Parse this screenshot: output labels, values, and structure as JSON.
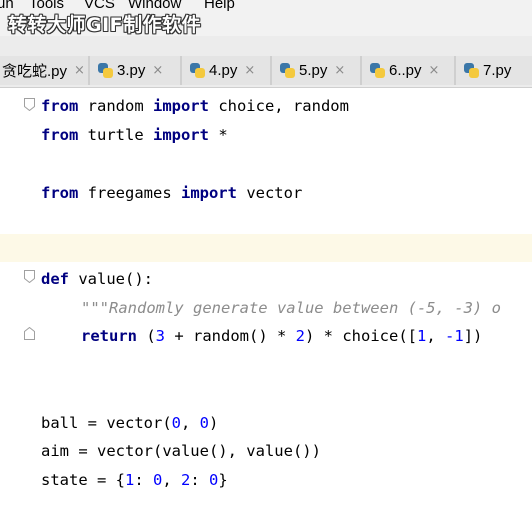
{
  "menu": {
    "items": [
      "un",
      "Tools",
      "VCS",
      "Window",
      "Help"
    ]
  },
  "watermark": "转转大师GIF制作软件",
  "tabs": [
    {
      "label": "贪吃蛇.py",
      "icon": "python-file-icon"
    },
    {
      "label": "3.py",
      "icon": "python-file-icon"
    },
    {
      "label": "4.py",
      "icon": "python-file-icon"
    },
    {
      "label": "5.py",
      "icon": "python-file-icon"
    },
    {
      "label": "6..py",
      "icon": "python-file-icon"
    },
    {
      "label": "7.py",
      "icon": "python-file-icon"
    }
  ],
  "tab_close_glyph": "×",
  "code": {
    "line1": {
      "kw1": "from",
      "t1": " random ",
      "kw2": "import",
      "t2": " choice, random"
    },
    "line2": {
      "kw1": "from",
      "t1": " turtle ",
      "kw2": "import",
      "t2": " *"
    },
    "line3": {
      "kw1": "from",
      "t1": " freegames ",
      "kw2": "import",
      "t2": " vector"
    },
    "line4": {
      "kw1": "def",
      "t1": " value():"
    },
    "line5": {
      "doc": "\"\"\"Randomly generate value between (-5, -3) o"
    },
    "line6": {
      "kw1": "return",
      "p1": " (",
      "n1": "3",
      "p2": " + random() * ",
      "n2": "2",
      "p3": ") * choice([",
      "n3": "1",
      "p4": ", ",
      "n4": "-1",
      "p5": "])"
    },
    "line7": {
      "t1": "ball = vector(",
      "n1": "0",
      "t2": ", ",
      "n2": "0",
      "t3": ")"
    },
    "line8": {
      "t1": "aim = vector(value(), value())"
    },
    "line9": {
      "t1": "state = {",
      "n1": "1",
      "t2": ": ",
      "n2": "0",
      "t3": ", ",
      "n3": "2",
      "t4": ": ",
      "n4": "0",
      "t5": "}"
    }
  },
  "colors": {
    "keyword": "#000080",
    "number": "#0000ff",
    "docstring": "#8c8c8c",
    "current_line": "#fdf9e7"
  }
}
